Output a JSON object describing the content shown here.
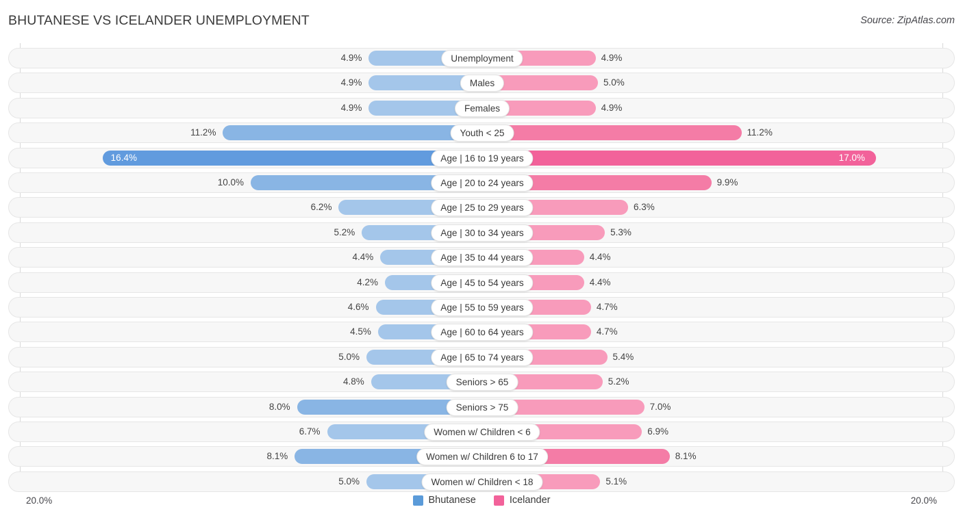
{
  "header": {
    "title": "BHUTANESE VS ICELANDER UNEMPLOYMENT",
    "source": "Source: ZipAtlas.com"
  },
  "axis": {
    "left_tick": "20.0%",
    "right_tick": "20.0%",
    "max": 20.0
  },
  "legend": {
    "items": [
      {
        "label": "Bhutanese",
        "color": "#5b9bd9"
      },
      {
        "label": "Icelander",
        "color": "#f2629a"
      }
    ]
  },
  "colors": {
    "left_light": "#a4c6ea",
    "left_mid": "#89b5e4",
    "left_dark": "#619bde",
    "right_light": "#f89bbb",
    "right_mid": "#f47ca6",
    "right_dark": "#f2629a",
    "row_bg": "#f7f7f7",
    "row_border": "#e6e6e6"
  },
  "chart_data": {
    "type": "bar",
    "title": "BHUTANESE VS ICELANDER UNEMPLOYMENT",
    "subtitle": "",
    "xlabel": "",
    "ylabel": "",
    "orientation": "horizontal-diverging",
    "grid": false,
    "legend_position": "bottom-center",
    "xlim": [
      20.0,
      20.0
    ],
    "axis_unit": "%",
    "categories": [
      "Unemployment",
      "Males",
      "Females",
      "Youth < 25",
      "Age | 16 to 19 years",
      "Age | 20 to 24 years",
      "Age | 25 to 29 years",
      "Age | 30 to 34 years",
      "Age | 35 to 44 years",
      "Age | 45 to 54 years",
      "Age | 55 to 59 years",
      "Age | 60 to 64 years",
      "Age | 65 to 74 years",
      "Seniors > 65",
      "Seniors > 75",
      "Women w/ Children < 6",
      "Women w/ Children 6 to 17",
      "Women w/ Children < 18"
    ],
    "series": [
      {
        "name": "Bhutanese",
        "side": "left",
        "color": "#5b9bd9",
        "values": [
          4.9,
          4.9,
          4.9,
          11.2,
          16.4,
          10.0,
          6.2,
          5.2,
          4.4,
          4.2,
          4.6,
          4.5,
          5.0,
          4.8,
          8.0,
          6.7,
          8.1,
          5.0
        ],
        "labels": [
          "4.9%",
          "4.9%",
          "4.9%",
          "11.2%",
          "16.4%",
          "10.0%",
          "6.2%",
          "5.2%",
          "4.4%",
          "4.2%",
          "4.6%",
          "4.5%",
          "5.0%",
          "4.8%",
          "8.0%",
          "6.7%",
          "8.1%",
          "5.0%"
        ]
      },
      {
        "name": "Icelander",
        "side": "right",
        "color": "#f2629a",
        "values": [
          4.9,
          5.0,
          4.9,
          11.2,
          17.0,
          9.9,
          6.3,
          5.3,
          4.4,
          4.4,
          4.7,
          4.7,
          5.4,
          5.2,
          7.0,
          6.9,
          8.1,
          5.1
        ],
        "labels": [
          "4.9%",
          "5.0%",
          "4.9%",
          "11.2%",
          "17.0%",
          "9.9%",
          "6.3%",
          "5.3%",
          "4.4%",
          "4.4%",
          "4.7%",
          "4.7%",
          "5.4%",
          "5.2%",
          "7.0%",
          "6.9%",
          "8.1%",
          "5.1%"
        ]
      }
    ]
  }
}
